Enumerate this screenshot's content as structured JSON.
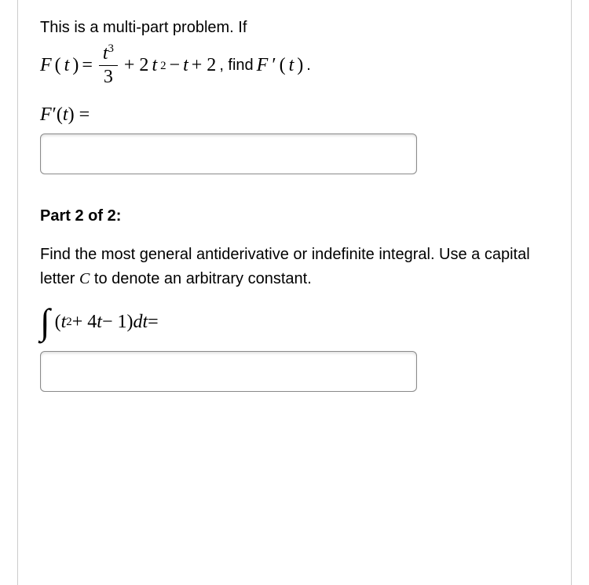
{
  "problem": {
    "intro_text": "This is a multi-part problem. If",
    "formula": {
      "lhs_fn": "F",
      "lhs_var": "t",
      "equals": " = ",
      "frac_num_base": "t",
      "frac_num_exp": "3",
      "frac_den": "3",
      "plus1": " + 2",
      "term2_base": "t",
      "term2_exp": "2",
      "minus": " − ",
      "term3_base": "t",
      "plus2": " + 2",
      "tail_text": ", find ",
      "tail_fn": "F",
      "tail_prime": "′",
      "tail_arg_open": "(",
      "tail_var": "t",
      "tail_arg_close": ")",
      "tail_period": "."
    },
    "answer_label": {
      "fn": "F",
      "prime": "′",
      "open": "(",
      "var": "t",
      "close": ")",
      "eq": " ="
    },
    "answer1_value": ""
  },
  "part2": {
    "heading": "Part 2 of 2:",
    "instruction_before_C": "Find the most general antiderivative or indefinite integral. Use a capital letter ",
    "C_symbol": "C",
    "instruction_after_C": " to denote an arbitrary constant.",
    "integral": {
      "sign": "∫",
      "open": " (",
      "base1": "t",
      "exp1": "2",
      "plus": " + 4",
      "base2": "t",
      "minus": " − 1",
      "close": ") ",
      "dvar": "dt",
      "eq": " ="
    },
    "answer2_value": ""
  }
}
